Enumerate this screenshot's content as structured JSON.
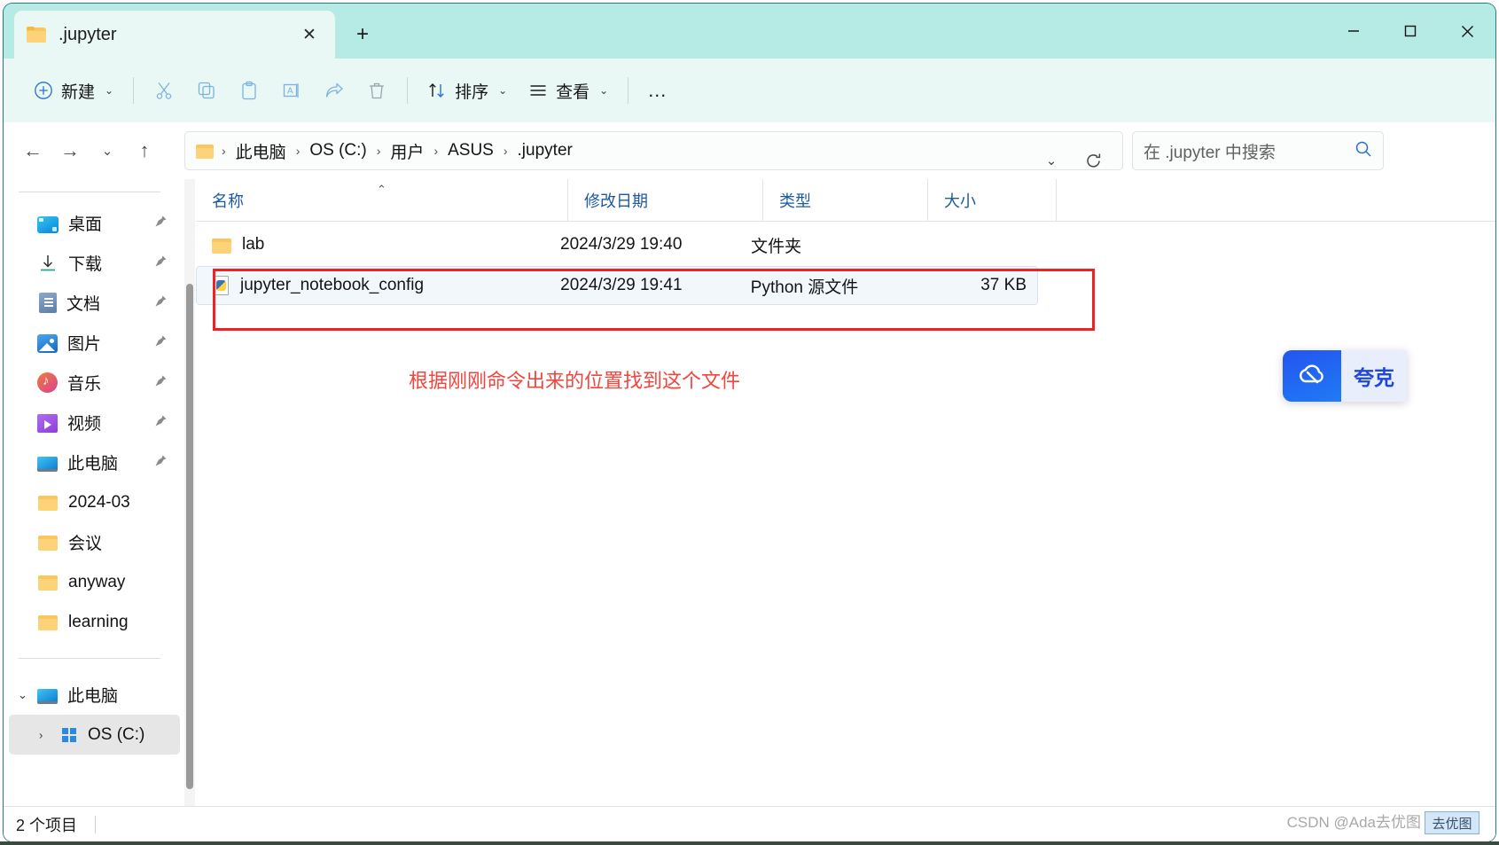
{
  "window": {
    "tab_title": ".jupyter",
    "tab_close_glyph": "✕",
    "new_tab_glyph": "+",
    "minimize_glyph": "—",
    "maximize_glyph": "☐",
    "close_glyph": "✕"
  },
  "toolbar": {
    "new_label": "新建",
    "sort_label": "排序",
    "view_label": "查看",
    "more_label": "…",
    "chevron": "⌄",
    "icons": {
      "cut": "cut-icon",
      "copy": "copy-icon",
      "paste": "paste-icon",
      "rename": "rename-icon",
      "share": "share-icon",
      "delete": "delete-icon"
    }
  },
  "address": {
    "back_glyph": "←",
    "forward_glyph": "→",
    "recent_glyph": "⌄",
    "up_glyph": "↑",
    "crumbs": [
      "此电脑",
      "OS (C:)",
      "用户",
      "ASUS",
      ".jupyter"
    ],
    "separator": "›",
    "dropdown_glyph": "⌄",
    "refresh_glyph": "↻"
  },
  "search": {
    "placeholder": "在 .jupyter 中搜索",
    "icon": "search-icon"
  },
  "sidebar": {
    "quick_access": [
      {
        "label": "桌面",
        "icon": "desktop-icon",
        "pinned": true
      },
      {
        "label": "下载",
        "icon": "download-icon",
        "pinned": true
      },
      {
        "label": "文档",
        "icon": "documents-icon",
        "pinned": true
      },
      {
        "label": "图片",
        "icon": "pictures-icon",
        "pinned": true
      },
      {
        "label": "音乐",
        "icon": "music-icon",
        "pinned": true
      },
      {
        "label": "视频",
        "icon": "video-icon",
        "pinned": true
      },
      {
        "label": "此电脑",
        "icon": "this-pc-icon",
        "pinned": true
      },
      {
        "label": "2024-03",
        "icon": "folder-icon",
        "pinned": false
      },
      {
        "label": "会议",
        "icon": "folder-icon",
        "pinned": false
      },
      {
        "label": "anyway",
        "icon": "folder-icon",
        "pinned": false
      },
      {
        "label": "learning",
        "icon": "folder-icon",
        "pinned": false
      }
    ],
    "tree": [
      {
        "label": "此电脑",
        "icon": "this-pc-icon",
        "expanded": true,
        "selected": false
      },
      {
        "label": "OS (C:)",
        "icon": "drive-icon",
        "expanded": false,
        "selected": true
      }
    ],
    "pin_glyph": "📌",
    "expand_glyph": "⌄",
    "collapse_glyph": "›"
  },
  "filelist": {
    "columns": [
      {
        "key": "name",
        "label": "名称",
        "sorted": true,
        "sort_glyph": "⌃"
      },
      {
        "key": "date",
        "label": "修改日期",
        "sorted": false,
        "sort_glyph": ""
      },
      {
        "key": "type",
        "label": "类型",
        "sorted": false,
        "sort_glyph": ""
      },
      {
        "key": "size",
        "label": "大小",
        "sorted": false,
        "sort_glyph": ""
      }
    ],
    "rows": [
      {
        "name": "lab",
        "date": "2024/3/29 19:40",
        "type": "文件夹",
        "size": "",
        "icon": "folder-icon",
        "selected": false
      },
      {
        "name": "jupyter_notebook_config",
        "date": "2024/3/29 19:41",
        "type": "Python 源文件",
        "size": "37 KB",
        "icon": "python-file-icon",
        "selected": true
      }
    ]
  },
  "annotation": {
    "note_text": "根据刚刚命令出来的位置找到这个文件",
    "color": "#f2453d",
    "box_color": "#ee2222"
  },
  "quark_popup": {
    "label": "夸克",
    "icon": "quark-cloud-icon",
    "brand_color": "#2454f0"
  },
  "statusbar": {
    "item_count": "2 个项目"
  },
  "watermark": {
    "text": "CSDN @Ada去优图",
    "badge_text": "去优图"
  }
}
